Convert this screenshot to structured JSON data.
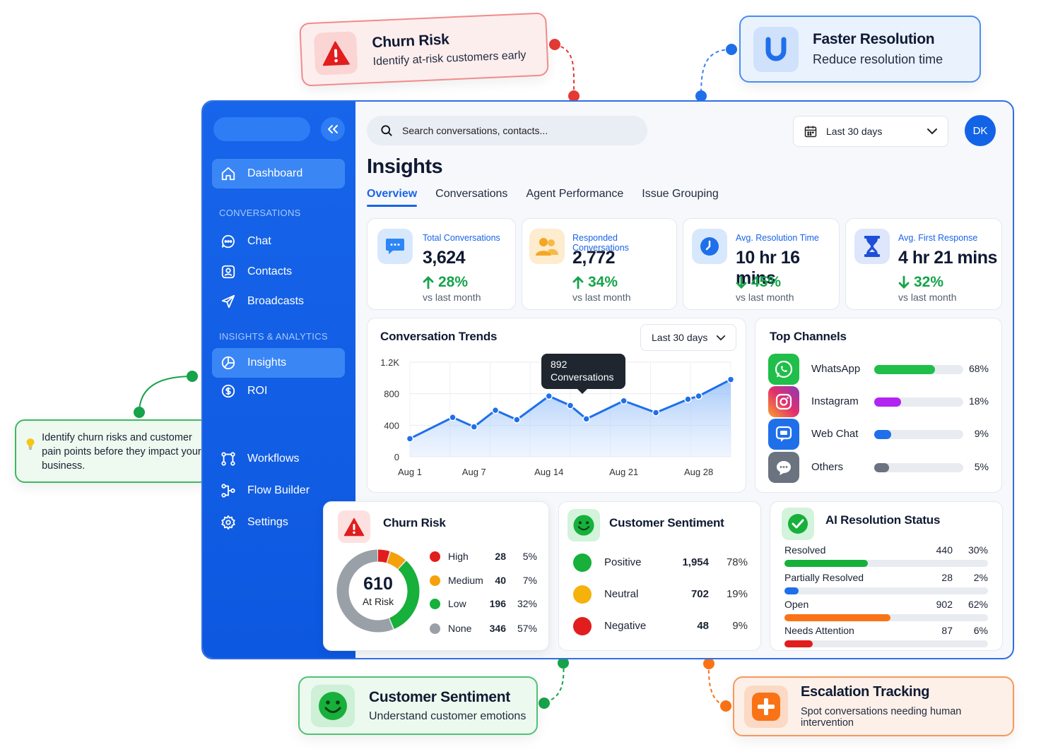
{
  "callouts": {
    "churn": {
      "title": "Churn Risk",
      "subtitle": "Identify at-risk customers early",
      "color": "#e53935"
    },
    "resolution": {
      "title": "Faster Resolution",
      "subtitle": "Reduce resolution time",
      "color": "#3b82f6"
    },
    "tip": {
      "text": "Identify churn risks and customer pain points before they impact your business."
    },
    "sentiment": {
      "title": "Customer Sentiment",
      "subtitle": "Understand customer emotions"
    },
    "escalation": {
      "title": "Escalation Tracking",
      "subtitle": "Spot conversations needing human intervention"
    }
  },
  "sidebar": {
    "items": [
      {
        "label": "Dashboard",
        "icon": "home-icon"
      },
      {
        "label": "Chat",
        "icon": "chat-icon"
      },
      {
        "label": "Contacts",
        "icon": "contacts-icon"
      },
      {
        "label": "Broadcasts",
        "icon": "send-icon"
      },
      {
        "label": "Insights",
        "icon": "pie-chart-icon"
      },
      {
        "label": "ROI",
        "icon": "dollar-icon"
      },
      {
        "label": "Workflows",
        "icon": "workflow-icon"
      },
      {
        "label": "Flow Builder",
        "icon": "flow-icon"
      },
      {
        "label": "Settings",
        "icon": "gear-icon"
      }
    ],
    "sections": [
      "CONVERSATIONS",
      "INSIGHTS & ANALYTICS"
    ]
  },
  "header": {
    "search_placeholder": "Search conversations, contacts...",
    "date_range": "Last 30 days",
    "avatar_initials": "DK"
  },
  "page": {
    "title": "Insights",
    "tabs": [
      "Overview",
      "Conversations",
      "Agent Performance",
      "Issue Grouping"
    ]
  },
  "stats": [
    {
      "label": "Total Conversations",
      "value": "3,624",
      "change": "28%",
      "direction": "up",
      "sub": "vs last month"
    },
    {
      "label": "Responded Conversations",
      "value": "2,772",
      "change": "34%",
      "direction": "up",
      "sub": "vs last month"
    },
    {
      "label": "Avg. Resolution Time",
      "value": "10 hr 16 mins",
      "change": "45%",
      "direction": "down",
      "sub": "vs last month"
    },
    {
      "label": "Avg. First Response",
      "value": "4 hr 21 mins",
      "change": "32%",
      "direction": "down",
      "sub": "vs last month"
    }
  ],
  "trends": {
    "title": "Conversation Trends",
    "range": "Last 30 days",
    "tooltip_value": "892",
    "tooltip_label": "Conversations"
  },
  "chart_data": {
    "type": "area",
    "title": "Conversation Trends",
    "x_ticks": [
      "Aug 1",
      "Aug 7",
      "Aug 14",
      "Aug 21",
      "Aug 28"
    ],
    "y_ticks": [
      "0",
      "400",
      "800",
      "1.2K"
    ],
    "ylim": [
      0,
      1200
    ],
    "xlim": [
      1,
      31
    ],
    "x": [
      1,
      5,
      7,
      9,
      11,
      14,
      16,
      17.5,
      21,
      24,
      27,
      28,
      31
    ],
    "y": [
      230,
      500,
      380,
      590,
      470,
      770,
      650,
      480,
      710,
      560,
      730,
      770,
      980
    ],
    "tooltip_point": {
      "x": 14,
      "y": 892
    }
  },
  "channels": {
    "title": "Top Channels",
    "items": [
      {
        "name": "WhatsApp",
        "pct": "68%",
        "fraction": 0.68,
        "color": "#1fbf4a",
        "icon": "whatsapp-icon"
      },
      {
        "name": "Instagram",
        "pct": "18%",
        "fraction": 0.3,
        "color": "#b224f0",
        "icon": "instagram-icon"
      },
      {
        "name": "Web Chat",
        "pct": "9%",
        "fraction": 0.19,
        "color": "#1f6fea",
        "icon": "webchat-icon"
      },
      {
        "name": "Others",
        "pct": "5%",
        "fraction": 0.17,
        "color": "#6b7280",
        "icon": "others-icon"
      }
    ]
  },
  "churn": {
    "title": "Churn Risk",
    "total": "610",
    "total_label": "At Risk",
    "levels": [
      {
        "name": "High",
        "count": "28",
        "pct": "5%",
        "fraction": 0.05,
        "color": "#e11d1d"
      },
      {
        "name": "Medium",
        "count": "40",
        "pct": "7%",
        "fraction": 0.07,
        "color": "#f5a10b"
      },
      {
        "name": "Low",
        "count": "196",
        "pct": "32%",
        "fraction": 0.32,
        "color": "#16b03a"
      },
      {
        "name": "None",
        "count": "346",
        "pct": "57%",
        "fraction": 0.56,
        "color": "#9aa0a8"
      }
    ]
  },
  "sentiment": {
    "title": "Customer Sentiment",
    "items": [
      {
        "name": "Positive",
        "count": "1,954",
        "pct": "78%",
        "color": "#16b03a"
      },
      {
        "name": "Neutral",
        "count": "702",
        "pct": "19%",
        "color": "#f5b20b"
      },
      {
        "name": "Negative",
        "count": "48",
        "pct": "9%",
        "color": "#e11d1d"
      }
    ]
  },
  "ai": {
    "title": "AI Resolution Status",
    "items": [
      {
        "name": "Resolved",
        "count": "440",
        "pct": "30%",
        "fraction": 0.41,
        "color": "#16b03a"
      },
      {
        "name": "Partially Resolved",
        "count": "28",
        "pct": "2%",
        "fraction": 0.07,
        "color": "#1f6fea"
      },
      {
        "name": "Open",
        "count": "902",
        "pct": "62%",
        "fraction": 0.52,
        "color": "#f97316"
      },
      {
        "name": "Needs Attention",
        "count": "87",
        "pct": "6%",
        "fraction": 0.14,
        "color": "#e11d1d"
      }
    ]
  }
}
